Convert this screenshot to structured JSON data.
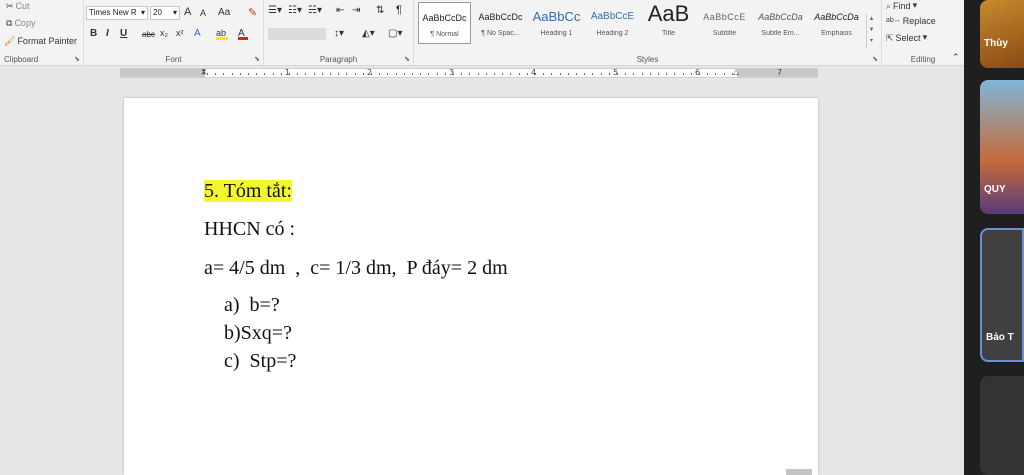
{
  "ribbon": {
    "clipboard": {
      "cut": "Cut",
      "copy": "Copy",
      "format_painter": "Format Painter",
      "label": "Clipboard"
    },
    "font": {
      "name": "Times New R",
      "size": "20",
      "grow": "A",
      "shrink": "A",
      "case": "Aa",
      "bold": "B",
      "italic": "I",
      "underline": "U",
      "strike": "abc",
      "subscript": "x₂",
      "superscript": "x²",
      "label": "Font"
    },
    "paragraph": {
      "label": "Paragraph"
    },
    "styles": {
      "label": "Styles",
      "items": [
        {
          "sample": "AaBbCcDc",
          "name": "¶ Normal"
        },
        {
          "sample": "AaBbCcDc",
          "name": "¶ No Spac..."
        },
        {
          "sample": "AaBbCc",
          "name": "Heading 1"
        },
        {
          "sample": "AaBbCcE",
          "name": "Heading 2"
        },
        {
          "sample": "AaB",
          "name": "Title"
        },
        {
          "sample": "AaBbCcE",
          "name": "Subtitle"
        },
        {
          "sample": "AaBbCcDa",
          "name": "Subtle Em..."
        },
        {
          "sample": "AaBbCcDa",
          "name": "Emphasis"
        }
      ]
    },
    "editing": {
      "find": "Find",
      "replace": "Replace",
      "select": "Select",
      "label": "Editing"
    }
  },
  "ruler": {
    "numbers": [
      "1",
      "2",
      "3",
      "4",
      "5",
      "6",
      "7"
    ]
  },
  "document": {
    "heading": "5. Tóm tắt:",
    "line1": "HHCN có :",
    "line2": "a= 4/5 dm  ,  c= 1/3 dm,  P đáy= 2 dm",
    "item_a": "a)  b=?",
    "item_b": "b)Sxq=?",
    "item_c": "c)  Stp=?"
  },
  "side_panel": {
    "thumb1_label": "Thùy",
    "thumb2_label": "QUY",
    "thumb3_label": "Bảo T"
  },
  "colors": {
    "highlight": "#f4f72b",
    "font_color_bar": "#e0201b",
    "highlight_bar": "#ffe600"
  }
}
